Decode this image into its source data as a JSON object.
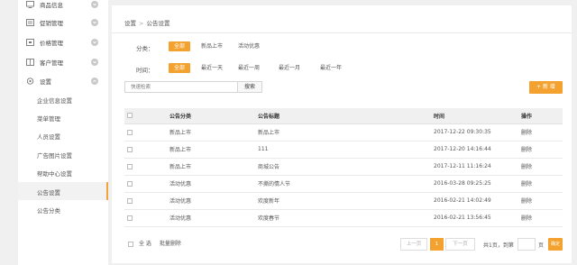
{
  "sidebar": {
    "items": [
      {
        "label": "商品信息",
        "icon": "monitor-icon"
      },
      {
        "label": "促销管理",
        "icon": "promotion-icon"
      },
      {
        "label": "价格管理",
        "icon": "price-icon"
      },
      {
        "label": "客户管理",
        "icon": "customer-icon"
      },
      {
        "label": "设置",
        "icon": "settings-icon"
      }
    ],
    "sub_items": [
      {
        "label": "企业信息设置"
      },
      {
        "label": "菜单管理"
      },
      {
        "label": "人员设置"
      },
      {
        "label": "广告图片设置"
      },
      {
        "label": "帮助中心设置"
      },
      {
        "label": "公告设置",
        "active": true
      },
      {
        "label": "公告分类"
      }
    ]
  },
  "breadcrumb": {
    "root": "设置",
    "separator": ">",
    "current": "公告设置"
  },
  "filters": {
    "category": {
      "label": "分类：",
      "options": [
        "全部",
        "新品上市",
        "活动优惠"
      ],
      "selected": "全部"
    },
    "time": {
      "label": "时间：",
      "options": [
        "全部",
        "最近一天",
        "最近一周",
        "最近一月",
        "最近一年"
      ],
      "selected": "全部"
    }
  },
  "search": {
    "placeholder": "快速检索",
    "button_label": "搜索"
  },
  "add_button": {
    "label": "+ 新 增"
  },
  "table": {
    "headers": [
      "公告分类",
      "公告标题",
      "时间",
      "操作"
    ],
    "rows": [
      {
        "category": "新品上市",
        "title": "新品上市",
        "time": "2017-12-22 09:30:35",
        "action": "删除"
      },
      {
        "category": "新品上市",
        "title": "111",
        "time": "2017-12-20 14:16:44",
        "action": "删除"
      },
      {
        "category": "新品上市",
        "title": "商城公告",
        "time": "2017-12-11 11:16:24",
        "action": "删除"
      },
      {
        "category": "活动优惠",
        "title": "不撕的情人节",
        "time": "2016-03-28 09:25:25",
        "action": "删除"
      },
      {
        "category": "活动优惠",
        "title": "欢度新年",
        "time": "2016-02-21 14:02:49",
        "action": "删除"
      },
      {
        "category": "活动优惠",
        "title": "欢度春节",
        "time": "2016-02-21 13:56:45",
        "action": "删除"
      }
    ]
  },
  "bulk": {
    "select_all": "全 选",
    "delete": "批量删除"
  },
  "pagination": {
    "prev": "上一页",
    "current": "1",
    "next": "下一页",
    "info": "共1页，到第",
    "unit": "页",
    "go": "确定"
  },
  "colors": {
    "accent": "#f4a22f"
  }
}
